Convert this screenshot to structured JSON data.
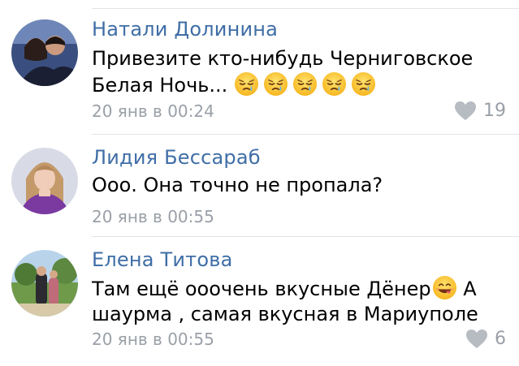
{
  "comments": [
    {
      "author": "Натали Долинина",
      "line1": "Привезите кто-нибудь Черниговское",
      "line2": "Белая Ночь...",
      "emojis": [
        "sleepy-face-icon",
        "sleepy-face-icon",
        "sleepy-face-icon",
        "sleepy-face-icon",
        "sleepy-face-icon"
      ],
      "date": "20 янв в 00:24",
      "likes": "19"
    },
    {
      "author": "Лидия Бессараб",
      "line1": "Ооо. Она точно не пропала?",
      "date": "20 янв в 00:55"
    },
    {
      "author": "Елена Титова",
      "line1a": "Там ещё ооочень вкусные Дёнер",
      "line1b": " А",
      "line2": "шаурма , самая вкусная в Мариуполе",
      "emoji": "yum-face-icon",
      "date": "20 янв в 00:55",
      "likes": "6"
    }
  ],
  "colors": {
    "author": "#3f6ea6",
    "meta": "#9aa0a8",
    "separator": "#e3e4e8"
  }
}
